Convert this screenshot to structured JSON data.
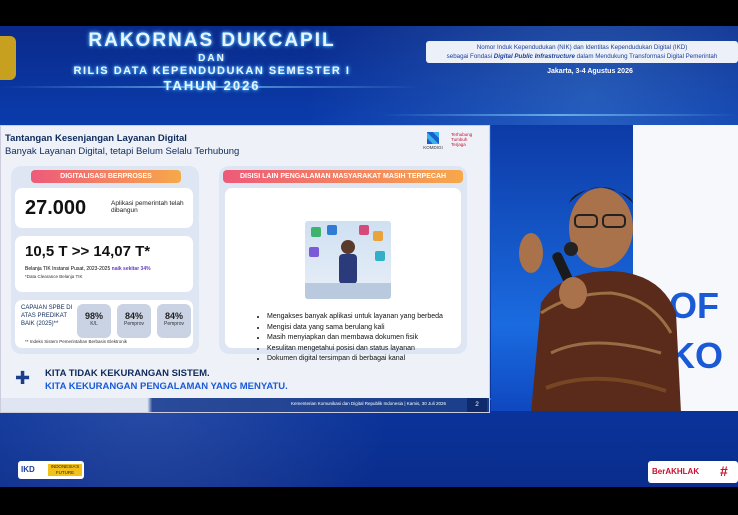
{
  "header": {
    "title_line1": "RAKORNAS DUKCAPIL",
    "title_line2": "DAN",
    "title_line3": "RILIS DATA KEPENDUDUKAN SEMESTER I",
    "title_line4": "TAHUN 2026",
    "subtitle_line1": "Nomor Induk Kependudukan (NIK) dan Identitas Kependudukan Digital (IKD)",
    "subtitle_line2_pre": "sebagai Fondasi ",
    "subtitle_line2_em": "Digital Public Infrastructure",
    "subtitle_line2_post": " dalam Mendukung Transformasi Digital Pemerintah",
    "date": "Jakarta, 3-4 Agustus 2026"
  },
  "slide": {
    "title": "Tantangan Kesenjangan Layanan Digital",
    "subtitle": "Banyak Layanan Digital, tetapi Belum Selalu Terhubung",
    "logo_komdigi": "KOMDIGI",
    "logo_terhubung": "Terhubung Tumbuh Terjaga",
    "left": {
      "pill": "DIGITALISASI BERPROSES",
      "stat1_value": "27.000",
      "stat1_label": "Aplikasi pemerintah telah dibangun",
      "stat2_value": "10,5 T >> 14,07 T*",
      "stat2_label": "Belanja TIK Instansi Pusat, 2023-2025",
      "stat2_growth": "naik sekitar 34%",
      "stat2_note": "*Data Clearance Belanja TIK",
      "spbe_label": "CAPAIAN SPBE DI ATAS PREDIKAT BAIK (2025)**",
      "spbe_note": "** Indeks Sistem Pemerintahan Berbasis Elektronik",
      "spbe": [
        {
          "value": "98%",
          "label": "K/L"
        },
        {
          "value": "84%",
          "label": "Pemprov"
        },
        {
          "value": "84%",
          "label": "Pemprov"
        }
      ]
    },
    "right": {
      "pill": "DISISI LAIN PENGALAMAN MASYARAKAT MASIH TERPECAH",
      "bullets": [
        "Mengakses banyak aplikasi untuk layanan yang berbeda",
        "Mengisi data yang sama berulang kali",
        "Masih menyiapkan dan membawa dokumen fisik",
        "Kesulitan mengetahui posisi dan status layanan",
        "Dokumen digital tersimpan di berbagai kanal"
      ]
    },
    "bottom_line1": "KITA TIDAK KEKURANGAN SISTEM.",
    "bottom_line2": "KITA KEKURANGAN PENGALAMAN YANG MENYATU.",
    "footer_text": "Kementerian Komunikasi dan Digital Republik Indonesia | Kamis, 30 Juli 2026",
    "page_number": "2"
  },
  "camera": {
    "backdrop_text_1": "OF",
    "backdrop_text_2": "KO"
  },
  "footer_logos": {
    "left": "IKD",
    "left_tag": "INDONESIA'S FUTURE",
    "right": "BerAKHLAK",
    "right_hashtag": "#"
  },
  "colors": {
    "stage_blue": "#0b47c2",
    "pill_gradient_start": "#ee5a7a",
    "pill_gradient_end": "#f7a84a",
    "accent_purple": "#6a3cc0",
    "accent_blue": "#1a5ad6"
  }
}
